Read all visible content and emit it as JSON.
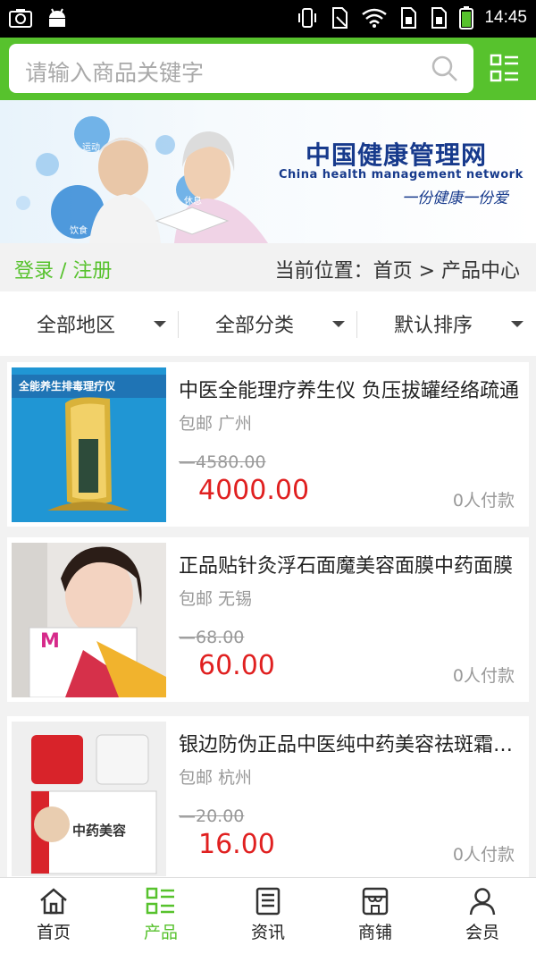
{
  "status": {
    "time": "14:45"
  },
  "search": {
    "placeholder": "请输入商品关键字"
  },
  "banner": {
    "title_cn": "中国健康管理网",
    "title_en": "China health management network",
    "slogan": "一份健康一份爱",
    "bubbles": [
      "运动",
      "饮食",
      "休息"
    ]
  },
  "crumb": {
    "login": "登录 / 注册",
    "location": "当前位置：首页 > 产品中心"
  },
  "filters": [
    "全部地区",
    "全部分类",
    "默认排序"
  ],
  "products": [
    {
      "title": "中医全能理疗养生仪 负压拔罐经络疏通",
      "shipping": "包邮 广州",
      "original_price": "4580.00",
      "price": "4000.00",
      "sold": "0人付款",
      "thumb_caption": "全能养生排毒理疗仪"
    },
    {
      "title": "正品贴针灸浮石面魔美容面膜中药面膜",
      "shipping": "包邮 无锡",
      "original_price": "68.00",
      "price": "60.00",
      "sold": "0人付款",
      "thumb_caption": "M"
    },
    {
      "title": "银边防伪正品中医纯中药美容祛斑霜套装",
      "shipping": "包邮 杭州",
      "original_price": "20.00",
      "price": "16.00",
      "sold": "0人付款",
      "thumb_caption": "中药美容"
    }
  ],
  "tabs": [
    {
      "label": "首页",
      "icon": "home-icon",
      "active": false
    },
    {
      "label": "产品",
      "icon": "grid-list-icon",
      "active": true
    },
    {
      "label": "资讯",
      "icon": "document-icon",
      "active": false
    },
    {
      "label": "商铺",
      "icon": "store-icon",
      "active": false
    },
    {
      "label": "会员",
      "icon": "person-icon",
      "active": false
    }
  ],
  "colors": {
    "accent": "#57c22d",
    "price": "#e02020",
    "brand_blue": "#173a8c"
  }
}
